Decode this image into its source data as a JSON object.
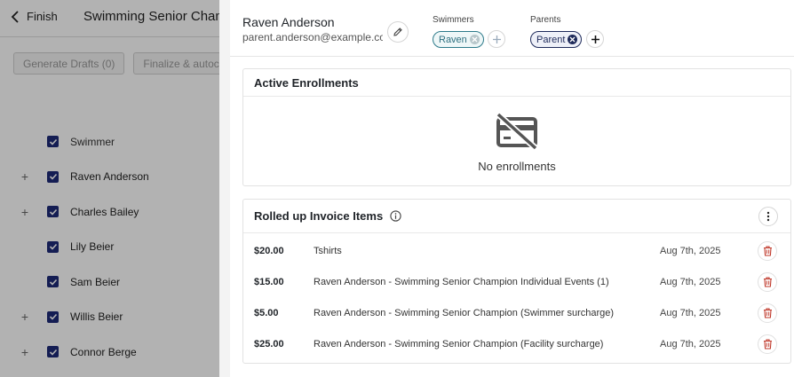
{
  "background": {
    "finish_label": "Finish",
    "title": "Swimming Senior Champio",
    "toolbar": [
      "Generate Drafts (0)",
      "Finalize & autoch"
    ],
    "table_header": "Swimmer",
    "rows": [
      {
        "name": "Raven Anderson",
        "expandable": true
      },
      {
        "name": "Charles Bailey",
        "expandable": true
      },
      {
        "name": "Lily Beier",
        "expandable": false
      },
      {
        "name": "Sam Beier",
        "expandable": false
      },
      {
        "name": "Willis Beier",
        "expandable": true
      },
      {
        "name": "Connor Berge",
        "expandable": true
      }
    ]
  },
  "profile": {
    "name": "Raven Anderson",
    "email": "parent.anderson@example.co",
    "swimmers_label": "Swimmers",
    "swimmer_chip": "Raven",
    "parents_label": "Parents",
    "parent_chip": "Parent"
  },
  "enrollments": {
    "title": "Active Enrollments",
    "empty_text": "No enrollments"
  },
  "invoice": {
    "title": "Rolled up Invoice Items",
    "items": [
      {
        "amount": "$20.00",
        "description": "Tshirts",
        "date": "Aug 7th, 2025"
      },
      {
        "amount": "$15.00",
        "description": "Raven Anderson - Swimming Senior Champion Individual Events (1)",
        "date": "Aug 7th, 2025"
      },
      {
        "amount": "$5.00",
        "description": "Raven Anderson - Swimming Senior Champion (Swimmer surcharge)",
        "date": "Aug 7th, 2025"
      },
      {
        "amount": "$25.00",
        "description": "Raven Anderson - Swimming Senior Champion (Facility surcharge)",
        "date": "Aug 7th, 2025"
      }
    ]
  },
  "colors": {
    "checkbox": "#1e2a78",
    "swimmer_chip": "#2d7a8a",
    "parent_chip": "#1e2a5a",
    "delete_icon": "#c0392b"
  }
}
